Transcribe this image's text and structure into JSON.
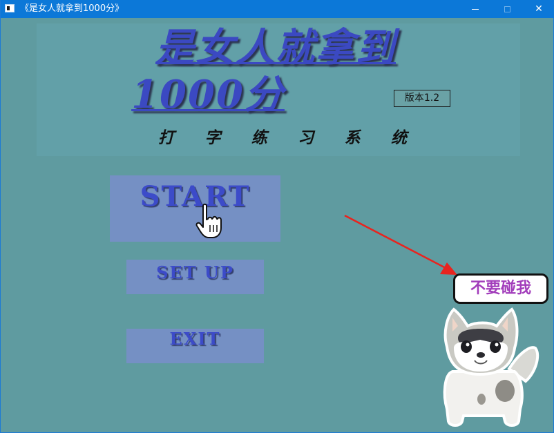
{
  "window": {
    "title": "《是女人就拿到1000分》",
    "minimize_symbol": "",
    "close_symbol": "✕"
  },
  "header": {
    "title_line1": "是女人就拿到",
    "title_line2": "1000分",
    "version": "版本1.2",
    "subtitle_chars": [
      "打",
      "字",
      "练",
      "习",
      "系",
      "统"
    ]
  },
  "menu": {
    "start_label": "START",
    "setup_label": "SET UP",
    "exit_label": "EXIT"
  },
  "mascot": {
    "speech": "不要碰我"
  },
  "colors": {
    "background": "#5f9ba0",
    "title_blue": "#3b49c2",
    "button_bg": "#7590c4",
    "arrow_red": "#e8241f",
    "speech_purple": "#a23dbb",
    "titlebar": "#0c78d8"
  },
  "icons": [
    "app-icon",
    "minimize-icon",
    "maximize-icon",
    "close-icon",
    "hand-pointer-cursor",
    "red-arrow",
    "husky-dog-mascot"
  ]
}
